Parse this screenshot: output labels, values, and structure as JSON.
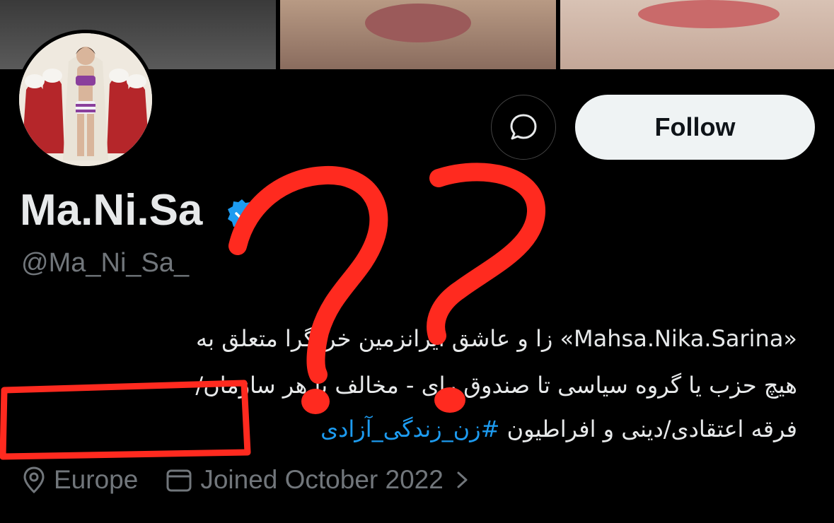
{
  "profile": {
    "display_name": "Ma.Ni.Sa",
    "handle": "@Ma_Ni_Sa_",
    "follow_label": "Follow",
    "bio": {
      "line1": "«Mahsa.Nika.Sarina» زا و عاشق ایرانزمین خردگرا متعلق به",
      "line2": "هیچ حزب یا گروه سیاسی تا صندوق رای - مخالف با هر سازمان/",
      "line3_text": "فرقه اعتقادی/دینی و افراطیون",
      "hashtag": "#زن_زندگی_آزادی"
    },
    "location": "Europe",
    "joined": "Joined October 2022"
  },
  "colors": {
    "background": "#000000",
    "accent": "#1d9bf0",
    "secondary_text": "#71767b",
    "annotation": "#ff2a1f"
  },
  "icons": [
    "message-icon",
    "verified-badge-icon",
    "location-icon",
    "calendar-icon",
    "chevron-right-icon"
  ]
}
